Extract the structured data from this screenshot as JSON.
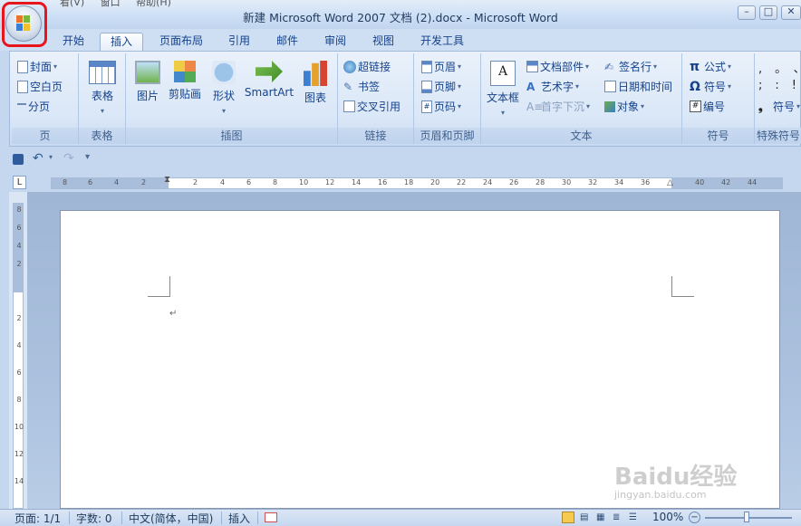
{
  "window": {
    "title": "新建 Microsoft Word 2007 文档 (2).docx - Microsoft Word",
    "behind_menu": [
      "看(V)",
      "窗口",
      "帮助(H)"
    ]
  },
  "tabs": [
    "开始",
    "插入",
    "页面布局",
    "引用",
    "邮件",
    "审阅",
    "视图",
    "开发工具"
  ],
  "active_tab": "插入",
  "ribbon": {
    "pages": {
      "label": "页",
      "items": [
        "封面",
        "空白页",
        "分页"
      ]
    },
    "table": {
      "label": "表格",
      "button": "表格"
    },
    "illustrations": {
      "label": "插图",
      "buttons": [
        "图片",
        "剪贴画",
        "形状",
        "SmartArt",
        "图表"
      ]
    },
    "links": {
      "label": "链接",
      "items": [
        "超链接",
        "书签",
        "交叉引用"
      ]
    },
    "header_footer": {
      "label": "页眉和页脚",
      "items": [
        "页眉",
        "页脚",
        "页码"
      ]
    },
    "text": {
      "label": "文本",
      "button": "文本框",
      "items": [
        "文档部件",
        "艺术字",
        "首字下沉",
        "签名行",
        "日期和时间",
        "对象"
      ]
    },
    "symbols": {
      "label": "符号",
      "items": [
        "公式",
        "符号",
        "编号"
      ]
    },
    "special": {
      "label": "特殊符号",
      "chars": [
        ",",
        "。",
        "、",
        ";",
        ":",
        "!"
      ],
      "item": "符号"
    }
  },
  "ruler": {
    "h_ticks": [
      "8",
      "6",
      "4",
      "2",
      "2",
      "4",
      "6",
      "8",
      "10",
      "12",
      "14",
      "16",
      "18",
      "20",
      "22",
      "24",
      "26",
      "28",
      "30",
      "32",
      "34",
      "36",
      "40",
      "42",
      "44"
    ],
    "v_ticks": [
      "8",
      "6",
      "4",
      "2",
      "2",
      "4",
      "6",
      "8",
      "10",
      "12",
      "14"
    ]
  },
  "status": {
    "page": "页面: 1/1",
    "words": "字数: 0",
    "language": "中文(简体，中国)",
    "mode": "插入",
    "zoom": "100%"
  },
  "watermark": {
    "brand": "Baidu经验",
    "url": "jingyan.baidu.com"
  },
  "colors": {
    "highlight": "#e8151c",
    "ribbon_text": "#15428b"
  }
}
